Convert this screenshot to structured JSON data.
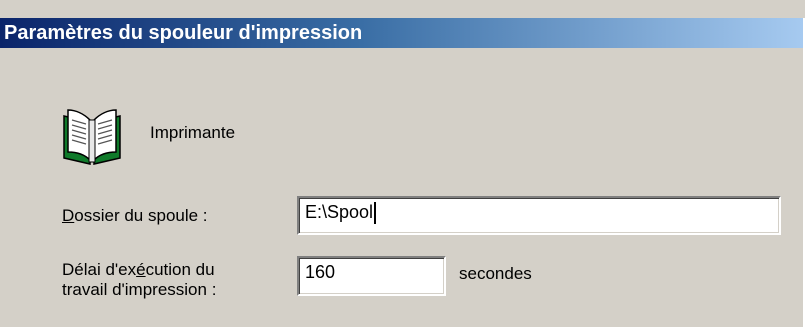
{
  "dialog": {
    "title": "Paramètres du spouleur d'impression"
  },
  "printer": {
    "icon": "printer-book-icon",
    "label": "Imprimante"
  },
  "spool_folder": {
    "label_access_key": "D",
    "label_rest": "ossier du spoule :",
    "value": "E:\\Spool"
  },
  "job_delay": {
    "label_line1_pre": "Délai d'ex",
    "label_line1_access_key": "é",
    "label_line1_post": "cution du",
    "label_line2": "travail d'impression :",
    "value": "160",
    "unit": "secondes"
  },
  "colors": {
    "window_face": "#d4d0c8",
    "titlebar_start": "#0a246a",
    "titlebar_end": "#a6caf0",
    "title_text": "#ffffff"
  }
}
